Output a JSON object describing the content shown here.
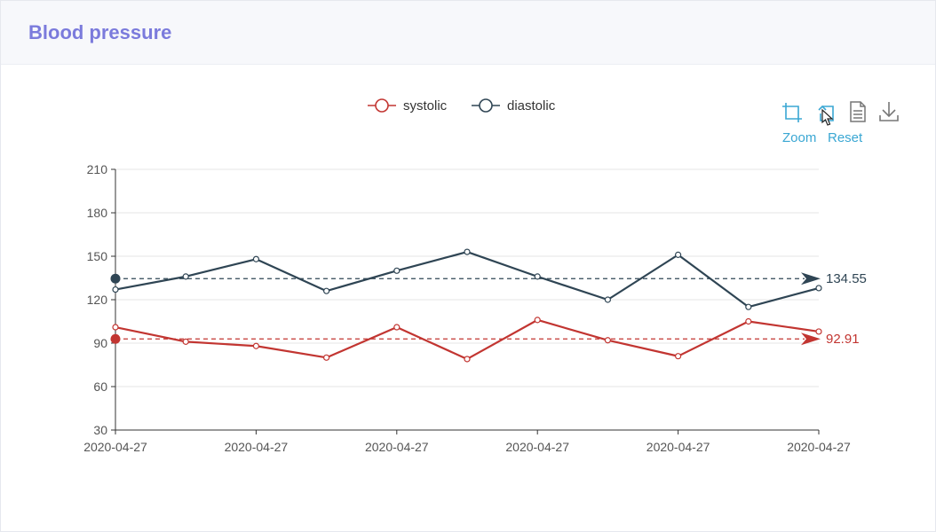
{
  "header": {
    "title": "Blood pressure"
  },
  "toolbox": {
    "zoom_label": "Zoom",
    "reset_label": "Reset",
    "icons": [
      "crop-icon",
      "undo-icon",
      "document-icon",
      "download-icon"
    ],
    "color": "#3aa7d3"
  },
  "chart_data": {
    "type": "line",
    "title": "",
    "xlabel": "",
    "ylabel": "",
    "ylim": [
      30,
      210
    ],
    "yticks": [
      30,
      60,
      90,
      120,
      150,
      180,
      210
    ],
    "x": [
      "2020-04-27",
      "2020-04-27",
      "2020-04-27",
      "2020-04-27",
      "2020-04-27",
      "2020-04-27",
      "2020-04-27",
      "2020-04-27",
      "2020-04-27",
      "2020-04-27",
      "2020-04-27"
    ],
    "x_tick_labels": [
      "2020-04-27",
      "2020-04-27",
      "2020-04-27",
      "2020-04-27",
      "2020-04-27",
      "2020-04-27"
    ],
    "grid": true,
    "legend_position": "top-center",
    "series": [
      {
        "name": "systolic",
        "color": "#c23531",
        "values": [
          101,
          91,
          88,
          80,
          101,
          79,
          106,
          92,
          81,
          105,
          98
        ],
        "mark_line_value": 92.91,
        "mark_line_label": "92.91"
      },
      {
        "name": "diastolic",
        "color": "#2f4554",
        "values": [
          127,
          136,
          148,
          126,
          140,
          153,
          136,
          120,
          151,
          115,
          128
        ],
        "mark_line_value": 134.55,
        "mark_line_label": "134.55"
      }
    ]
  }
}
